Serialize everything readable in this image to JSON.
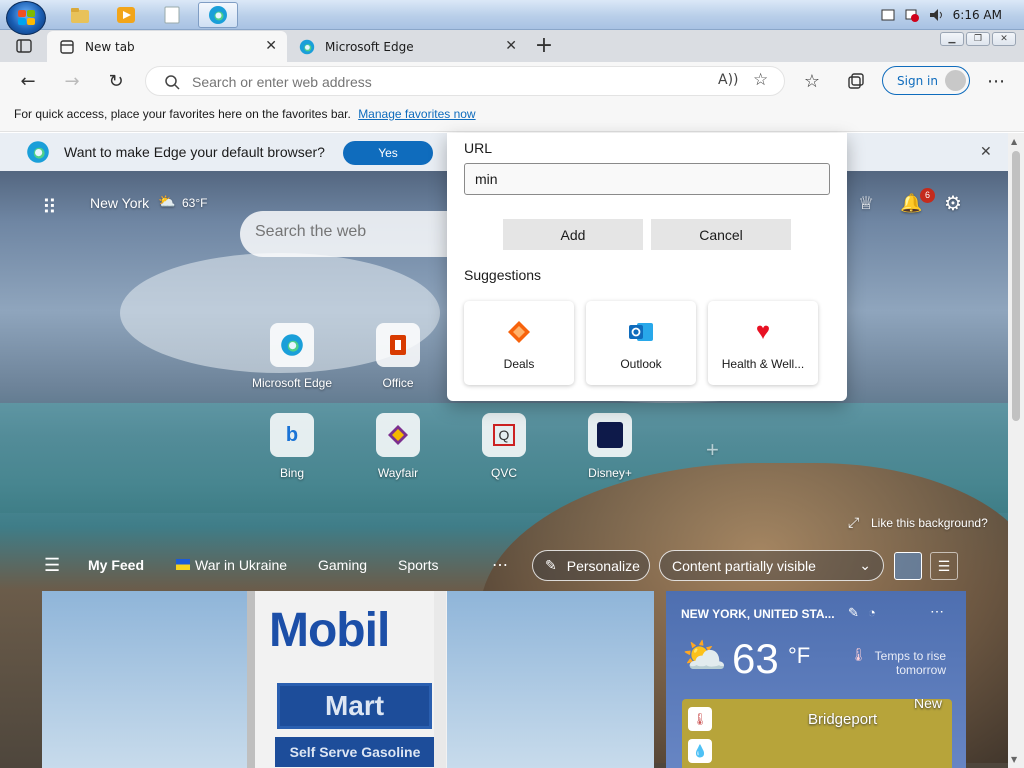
{
  "taskbar": {
    "clock": "6:16 AM"
  },
  "tabs": [
    {
      "label": "New tab",
      "active": true
    },
    {
      "label": "Microsoft Edge",
      "active": false
    }
  ],
  "toolbar": {
    "address_placeholder": "Search or enter web address",
    "signin_label": "Sign in"
  },
  "favorites_bar": {
    "text": "For quick access, place your favorites here on the favorites bar.",
    "link": "Manage favorites now"
  },
  "default_browser_bar": {
    "prompt": "Want to make Edge your default browser?",
    "yes_label": "Yes"
  },
  "ntp": {
    "location": "New York",
    "temperature": "63°F",
    "search_placeholder": "Search the web",
    "notification_count": "6",
    "quick_links": [
      {
        "label": "Microsoft Edge",
        "icon": "edge-icon"
      },
      {
        "label": "Office",
        "icon": "office-icon"
      },
      {
        "label": "Bing",
        "icon": "bing-icon"
      },
      {
        "label": "Wayfair",
        "icon": "wayfair-icon"
      },
      {
        "label": "QVC",
        "icon": "qvc-icon"
      },
      {
        "label": "Disney+",
        "icon": "disney-icon"
      }
    ],
    "like_background": "Like this background?",
    "feed_tabs": [
      "My Feed",
      "War in Ukraine",
      "Gaming",
      "Sports"
    ],
    "personalize_label": "Personalize",
    "content_visibility": "Content partially visible",
    "news_card": {
      "sign_word": "Mobil",
      "mart": "Mart",
      "subtitle": "Self Serve Gasoline"
    },
    "weather_card": {
      "location": "NEW YORK, UNITED STA...",
      "temp": "63",
      "unit": "°F",
      "note": "Temps to rise tomorrow",
      "map_label": "Bridgeport",
      "map_label_2": "New"
    }
  },
  "add_favorite_popup": {
    "url_label": "URL",
    "url_value": "min",
    "add_label": "Add",
    "cancel_label": "Cancel",
    "suggestions_title": "Suggestions",
    "suggestions": [
      {
        "label": "Deals",
        "icon": "deals-icon"
      },
      {
        "label": "Outlook",
        "icon": "outlook-icon"
      },
      {
        "label": "Health & Well...",
        "icon": "heart-icon"
      }
    ]
  },
  "colors": {
    "accent": "#0f6cbd",
    "heart": "#e81123",
    "deals": "#f7630c"
  }
}
